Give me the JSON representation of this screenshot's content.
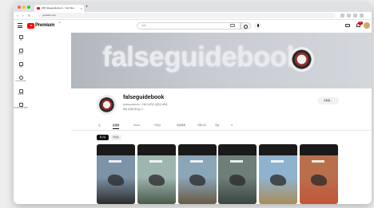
{
  "browser": {
    "tab_title": "(95) falseguidebook - YouTube",
    "tab_close": "×",
    "new_tab": "+",
    "url": "youtube.com"
  },
  "header": {
    "logo_text": "Premium",
    "logo_country": "KR",
    "search_placeholder": "검색",
    "notifications": "9+"
  },
  "sidebar": {
    "items": [
      {
        "label": "홈",
        "icon": "home-icon"
      },
      {
        "label": "Shorts",
        "icon": "shorts-icon"
      },
      {
        "label": "구독",
        "icon": "subscriptions-icon"
      },
      {
        "label": "YouTube Music",
        "icon": "music-icon"
      },
      {
        "label": "내 페이지",
        "icon": "library-icon"
      },
      {
        "label": "오프라인 저장 동영상",
        "icon": "download-icon"
      }
    ]
  },
  "banner": {
    "text": "falseguidebook"
  },
  "channel": {
    "name": "falseguidebook",
    "meta": "@falseguidebook • 구독자 1만명 • 동영상 135개",
    "description": "채널 자세히 알아보기 >",
    "subscribe_label": "구독중 ⌄"
  },
  "tabs": [
    {
      "label": "홈",
      "active": false
    },
    {
      "label": "동영상",
      "active": true
    },
    {
      "label": "Shorts",
      "active": false
    },
    {
      "label": "라이브",
      "active": false
    },
    {
      "label": "재생목록",
      "active": false
    },
    {
      "label": "커뮤니티",
      "active": false
    },
    {
      "label": "정보",
      "active": false
    }
  ],
  "chips": [
    {
      "label": "최신순",
      "active": true
    },
    {
      "label": "인기순",
      "active": false
    }
  ],
  "thumbnails": [
    {
      "sky": "#7c93a8",
      "ground": "#2c2c2c"
    },
    {
      "sky": "#9fb5b0",
      "ground": "#4a5a4c"
    },
    {
      "sky": "#8aa6b8",
      "ground": "#6b5a44"
    },
    {
      "sky": "#6e7f7a",
      "ground": "#3b4640"
    },
    {
      "sky": "#8fb3cf",
      "ground": "#a88d5a"
    },
    {
      "sky": "#b96f4c",
      "ground": "#c2553a"
    }
  ],
  "colors": {
    "brand_red": "#ff0000",
    "banner_start": "#b2b6bd",
    "banner_end": "#d3d6db"
  }
}
